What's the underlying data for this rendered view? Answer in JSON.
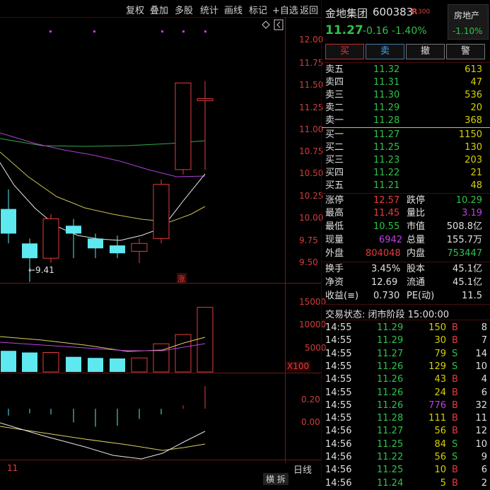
{
  "toolbar": {
    "items": [
      "复权",
      "叠加",
      "多股",
      "统计",
      "画线",
      "标记",
      "+自选",
      "返回"
    ],
    "ellipsis": "…"
  },
  "price_axis": [
    "12.00",
    "11.75",
    "11.50",
    "11.25",
    "11.00",
    "10.75",
    "10.50",
    "10.25",
    "10.00",
    "9.75",
    "9.50"
  ],
  "low_marker": "←9.41",
  "zhang_marker": "涨",
  "volume_axis": [
    "15000",
    "10000",
    "5000"
  ],
  "volume_unit": "X100",
  "macd_axis": [
    "0.20",
    "0.00"
  ],
  "date_label": "11",
  "period_label": "日线",
  "bottom_hint": "横 拆",
  "stock": {
    "name": "金地集团",
    "code": "600383",
    "r_label": "R",
    "index_label": "300",
    "price": "11.27",
    "change": "-0.16",
    "change_pct": "-1.40%",
    "sector_name": "房地产",
    "sector_change": "-1.10%"
  },
  "actions": {
    "buy": "买",
    "sell": "卖",
    "cancel": "撤",
    "alert": "警"
  },
  "asks": [
    {
      "label": "卖五",
      "price": "11.32",
      "vol": "613"
    },
    {
      "label": "卖四",
      "price": "11.31",
      "vol": "47"
    },
    {
      "label": "卖三",
      "price": "11.30",
      "vol": "536"
    },
    {
      "label": "卖二",
      "price": "11.29",
      "vol": "20"
    },
    {
      "label": "卖一",
      "price": "11.28",
      "vol": "368"
    }
  ],
  "bids": [
    {
      "label": "买一",
      "price": "11.27",
      "vol": "1150"
    },
    {
      "label": "买二",
      "price": "11.25",
      "vol": "130"
    },
    {
      "label": "买三",
      "price": "11.23",
      "vol": "203"
    },
    {
      "label": "买四",
      "price": "11.22",
      "vol": "21"
    },
    {
      "label": "买五",
      "price": "11.21",
      "vol": "48"
    }
  ],
  "stats": {
    "limit_up_label": "涨停",
    "limit_up": "12.57",
    "limit_down_label": "跌停",
    "limit_down": "10.29",
    "high_label": "最高",
    "high": "11.45",
    "vol_ratio_label": "量比",
    "vol_ratio": "3.19",
    "low_label": "最低",
    "low": "10.55",
    "mktcap_label": "市值",
    "mktcap": "508.8亿",
    "current_vol_label": "现量",
    "current_vol": "6942",
    "total_vol_label": "总量",
    "total_vol": "155.7万",
    "outer_label": "外盘",
    "outer": "804048",
    "inner_label": "内盘",
    "inner": "753447",
    "turnover_label": "换手",
    "turnover": "3.45%",
    "capital_label": "股本",
    "capital": "45.1亿",
    "nav_label": "净资",
    "nav": "12.69",
    "float_label": "流通",
    "float": "45.1亿",
    "eps_label": "收益(≡)",
    "eps": "0.730",
    "pe_label": "PE(动)",
    "pe": "11.5"
  },
  "trade_status": "交易状态: 闭市阶段 15:00:00",
  "trades": [
    {
      "time": "14:55",
      "price": "11.29",
      "vol": "150",
      "side": "B",
      "n": "8"
    },
    {
      "time": "14:55",
      "price": "11.29",
      "vol": "30",
      "side": "B",
      "n": "7"
    },
    {
      "time": "14:55",
      "price": "11.27",
      "vol": "79",
      "side": "S",
      "n": "14"
    },
    {
      "time": "14:55",
      "price": "11.26",
      "vol": "129",
      "side": "S",
      "n": "10"
    },
    {
      "time": "14:55",
      "price": "11.26",
      "vol": "43",
      "side": "B",
      "n": "4"
    },
    {
      "time": "14:55",
      "price": "11.26",
      "vol": "24",
      "side": "B",
      "n": "6"
    },
    {
      "time": "14:55",
      "price": "11.26",
      "vol": "776",
      "side": "B",
      "n": "32"
    },
    {
      "time": "14:55",
      "price": "11.28",
      "vol": "111",
      "side": "B",
      "n": "11"
    },
    {
      "time": "14:56",
      "price": "11.27",
      "vol": "56",
      "side": "B",
      "n": "12"
    },
    {
      "time": "14:56",
      "price": "11.25",
      "vol": "84",
      "side": "S",
      "n": "10"
    },
    {
      "time": "14:56",
      "price": "11.22",
      "vol": "56",
      "side": "S",
      "n": "9"
    },
    {
      "time": "14:56",
      "price": "11.25",
      "vol": "10",
      "side": "B",
      "n": "6"
    },
    {
      "time": "14:56",
      "price": "11.24",
      "vol": "5",
      "side": "B",
      "n": "2"
    }
  ],
  "chart_data": {
    "type": "candlestick",
    "price_ticks": [
      12.0,
      11.75,
      11.5,
      11.25,
      11.0,
      10.75,
      10.5,
      10.25,
      10.0,
      9.75,
      9.5
    ],
    "ylim": [
      9.4,
      12.1
    ],
    "candles": [
      {
        "open": 9.9,
        "close": 10.15,
        "high": 10.35,
        "low": 9.8,
        "dir": "down"
      },
      {
        "open": 9.65,
        "close": 9.8,
        "high": 9.85,
        "low": 9.41,
        "dir": "down"
      },
      {
        "open": 9.65,
        "close": 10.05,
        "high": 10.1,
        "low": 9.6,
        "dir": "up"
      },
      {
        "open": 9.9,
        "close": 9.98,
        "high": 10.05,
        "low": 9.65,
        "dir": "down"
      },
      {
        "open": 9.75,
        "close": 9.85,
        "high": 9.9,
        "low": 9.65,
        "dir": "down"
      },
      {
        "open": 9.7,
        "close": 9.78,
        "high": 9.88,
        "low": 9.65,
        "dir": "down"
      },
      {
        "open": 9.72,
        "close": 9.8,
        "high": 9.85,
        "low": 9.6,
        "dir": "up"
      },
      {
        "open": 9.85,
        "close": 10.4,
        "high": 10.45,
        "low": 9.8,
        "dir": "up"
      },
      {
        "open": 10.55,
        "close": 11.43,
        "high": 11.43,
        "low": 10.5,
        "dir": "up"
      },
      {
        "open": 11.25,
        "close": 11.27,
        "high": 11.45,
        "low": 10.55,
        "dir": "up"
      }
    ],
    "volume": {
      "ticks": [
        15000,
        10000,
        5000
      ],
      "ylim": [
        0,
        16500
      ],
      "values": [
        4000,
        3700,
        3700,
        2900,
        2700,
        2600,
        2700,
        5300,
        7000,
        12000
      ],
      "dirs": [
        "down",
        "down",
        "up",
        "down",
        "down",
        "down",
        "up",
        "up",
        "up",
        "up"
      ]
    },
    "macd": {
      "ticks": [
        0.2,
        0.0
      ],
      "ylim": [
        -0.45,
        0.32
      ],
      "values": [
        -0.06,
        -0.04,
        -0.05,
        -0.12,
        -0.16,
        -0.15,
        -0.09,
        -0.05,
        0.03,
        0.2
      ]
    }
  }
}
